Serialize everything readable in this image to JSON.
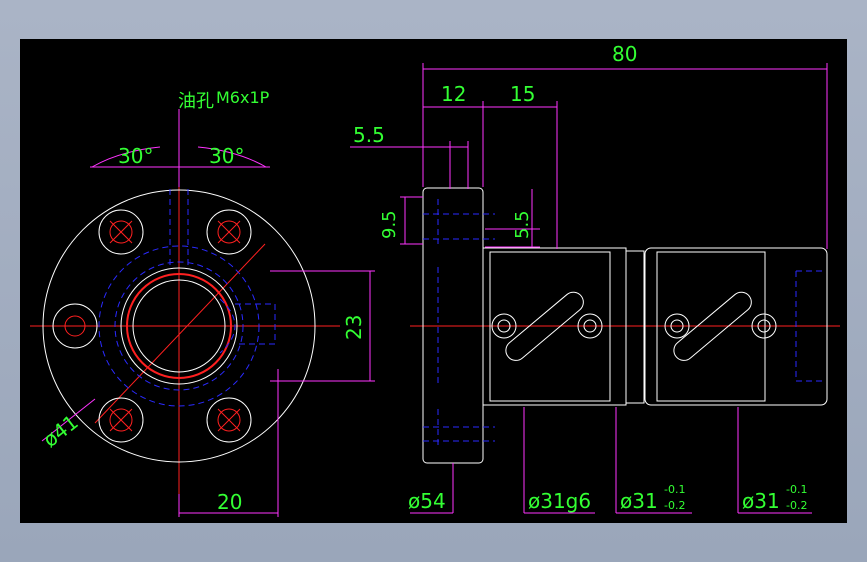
{
  "oil_hole_label": "油孔",
  "thread_label": "M6x1P",
  "left_view": {
    "angle_left": "30°",
    "angle_right": "30°",
    "height_dim": "23",
    "pcd_dim": "ø41",
    "width_dim": "20"
  },
  "right_view": {
    "overall_length": "80",
    "flange_width": "12",
    "step_width": "15",
    "offset_dim": "5.5",
    "hole_dim_a": "9.5",
    "hole_dim_b": "5.5",
    "flange_dia": "ø54",
    "fit_dia": "ø31g6",
    "dia_1": "ø31",
    "dia_1_upper": "-0.1",
    "dia_1_lower": "-0.2",
    "dia_2": "ø31",
    "dia_2_upper": "-0.1",
    "dia_2_lower": "-0.2"
  }
}
